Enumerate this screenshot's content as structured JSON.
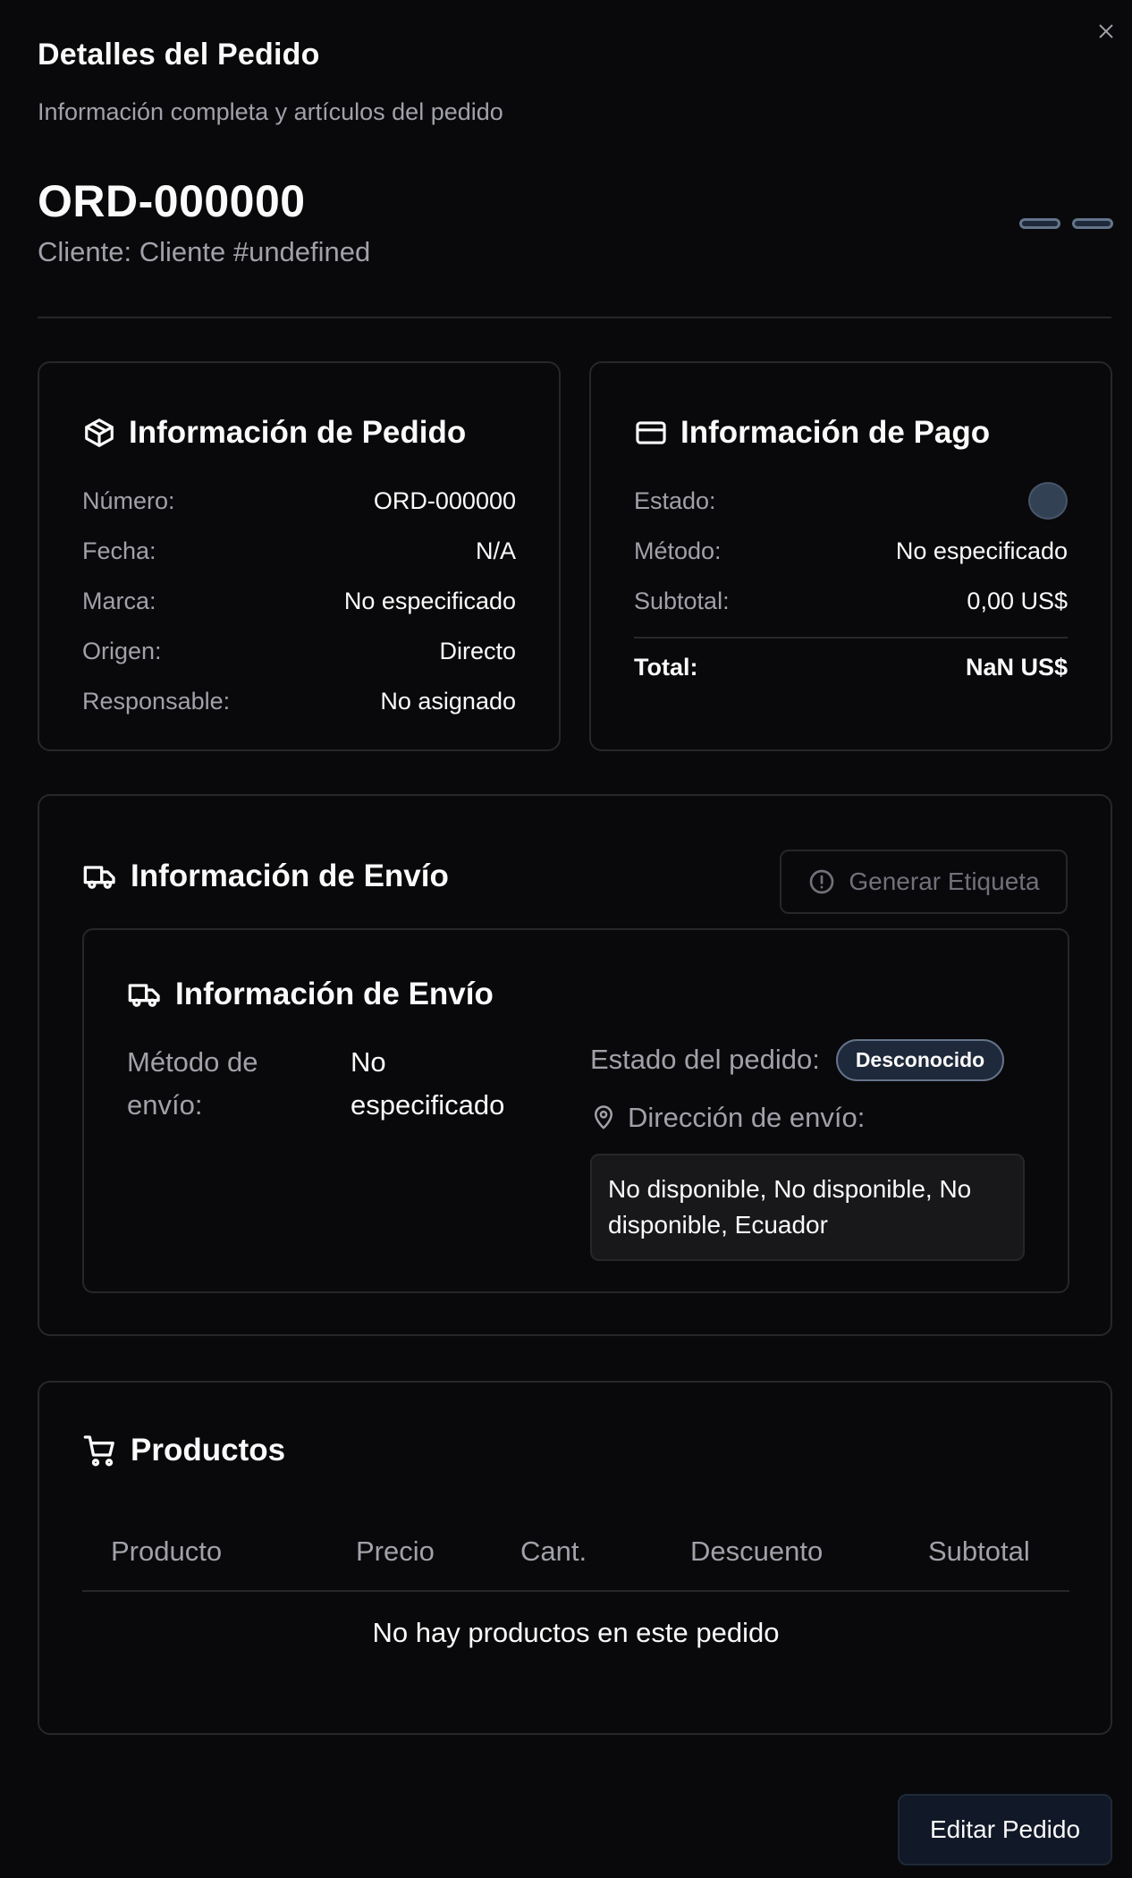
{
  "dialog": {
    "title": "Detalles del Pedido",
    "subtitle": "Información completa y artículos del pedido",
    "order_code": "ORD-000000",
    "client": "Cliente: Cliente #undefined"
  },
  "order_info": {
    "title": "Información de Pedido",
    "rows": [
      {
        "label": "Número:",
        "value": "ORD-000000"
      },
      {
        "label": "Fecha:",
        "value": "N/A"
      },
      {
        "label": "Marca:",
        "value": "No especificado"
      },
      {
        "label": "Origen:",
        "value": "Directo"
      },
      {
        "label": "Responsable:",
        "value": "No asignado"
      }
    ]
  },
  "payment_info": {
    "title": "Información de Pago",
    "estado_label": "Estado:",
    "rows": [
      {
        "label": "Método:",
        "value": "No especificado"
      },
      {
        "label": "Subtotal:",
        "value": "0,00 US$"
      }
    ],
    "total_label": "Total:",
    "total_value": "NaN US$"
  },
  "shipping": {
    "title": "Información de Envío",
    "generate_label": "Generar Etiqueta",
    "inner_title": "Información de Envío",
    "method_label": "Método de envío:",
    "method_value": "No especificado",
    "status_label": "Estado del pedido:",
    "status_badge": "Desconocido",
    "address_label": "Dirección de envío:",
    "address_value": "No disponible, No disponible, No disponible, Ecuador"
  },
  "products": {
    "title": "Productos",
    "columns": [
      "Producto",
      "Precio",
      "Cant.",
      "Descuento",
      "Subtotal"
    ],
    "empty": "No hay productos en este pedido"
  },
  "footer": {
    "edit_label": "Editar Pedido"
  },
  "icons": {
    "close": "close-icon",
    "package": "package-icon",
    "card": "credit-card-icon",
    "truck": "truck-icon",
    "alert": "alert-circle-icon",
    "map_pin": "map-pin-icon",
    "cart": "shopping-cart-icon"
  }
}
